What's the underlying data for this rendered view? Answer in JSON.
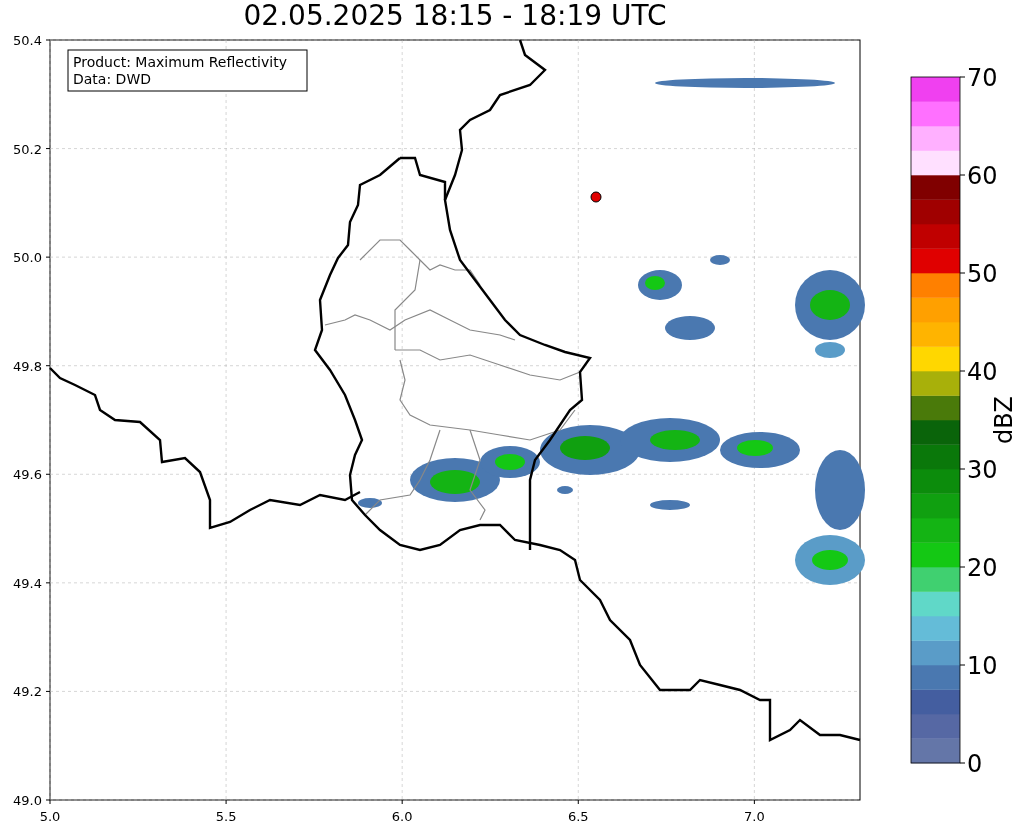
{
  "title": "02.05.2025 18:15 - 18:19 UTC",
  "info_box": [
    "Product: Maximum Reflectivity",
    "Data: DWD"
  ],
  "map": {
    "x_ticks": [
      "5.0",
      "5.5",
      "6.0",
      "6.5",
      "7.0"
    ],
    "y_ticks": [
      "50.4",
      "50.2",
      "50.0",
      "49.8",
      "49.6",
      "49.4",
      "49.2",
      "49.0"
    ]
  },
  "colorbar": {
    "label": "dBZ",
    "ticks": [
      "70",
      "60",
      "50",
      "40",
      "30",
      "20",
      "10",
      "0"
    ],
    "bands": [
      {
        "color": "#6476a8"
      },
      {
        "color": "#5668a4"
      },
      {
        "color": "#445ea0"
      },
      {
        "color": "#4a78b0"
      },
      {
        "color": "#5a9cc8"
      },
      {
        "color": "#64bcd8"
      },
      {
        "color": "#60d8c8"
      },
      {
        "color": "#40d070"
      },
      {
        "color": "#14c814"
      },
      {
        "color": "#14b414"
      },
      {
        "color": "#10a010"
      },
      {
        "color": "#0c8c0c"
      },
      {
        "color": "#0a780a"
      },
      {
        "color": "#0a640a"
      },
      {
        "color": "#4a7a0a"
      },
      {
        "color": "#a8b00a"
      },
      {
        "color": "#ffd700"
      },
      {
        "color": "#ffb400"
      },
      {
        "color": "#ffa000"
      },
      {
        "color": "#ff8000"
      },
      {
        "color": "#e00000"
      },
      {
        "color": "#c00000"
      },
      {
        "color": "#a00000"
      },
      {
        "color": "#800000"
      },
      {
        "color": "#ffe0ff"
      },
      {
        "color": "#ffb0ff"
      },
      {
        "color": "#ff70ff"
      },
      {
        "color": "#f040f0"
      }
    ]
  }
}
